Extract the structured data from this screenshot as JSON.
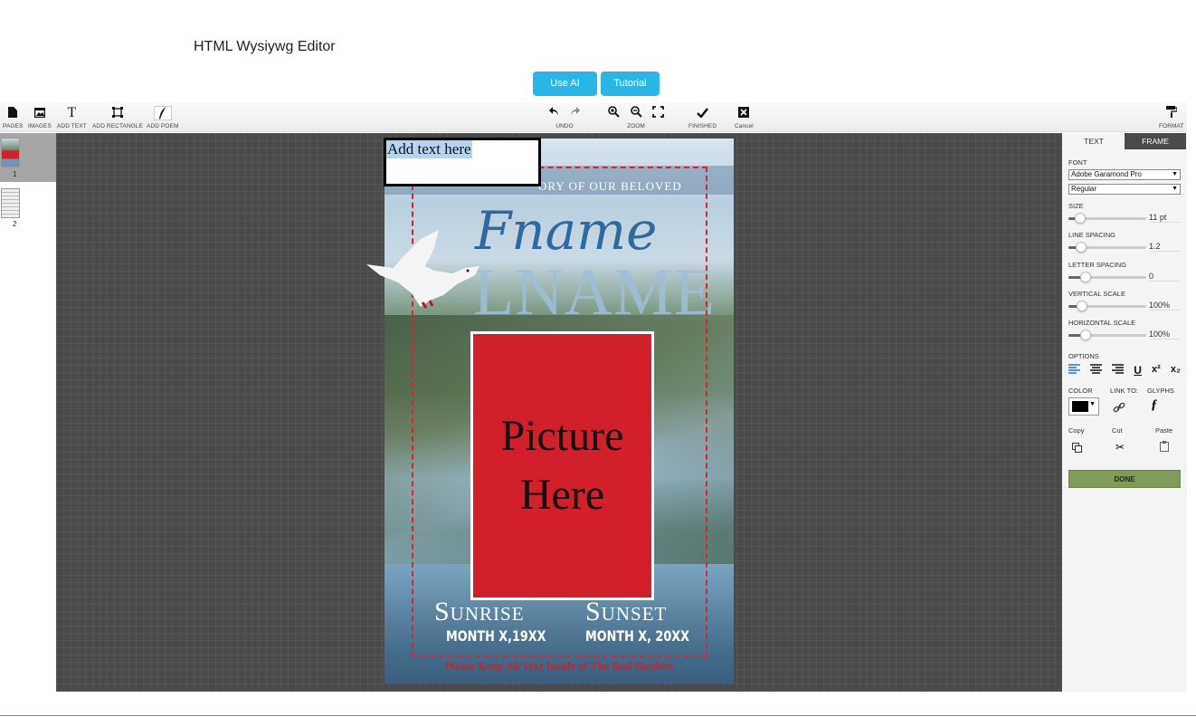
{
  "page": {
    "title": "HTML Wysiywg Editor"
  },
  "top_buttons": {
    "use_ai": "Use AI",
    "tutorial": "Tutorial"
  },
  "toolbar": {
    "pages": "PAGES",
    "images": "IMAGES",
    "add_text": "ADD TEXT",
    "add_rectangle": "ADD RECTANGLE",
    "add_poem": "ADD POEM",
    "undo": "UNDO",
    "zoom": "ZOOM",
    "finished": "FINISHED",
    "cancel": "Cancel",
    "format": "FORMAT"
  },
  "page_thumbs": [
    {
      "num": "1"
    },
    {
      "num": "2"
    }
  ],
  "card": {
    "top_text": "ORY OF OUR BELOVED",
    "fname": "Fname",
    "lname": "LNAME",
    "picture_line1": "Picture",
    "picture_line2": "Here",
    "sunrise": "Sunrise",
    "sunset": "Sunset",
    "date1": "MONTH X,19XX",
    "date2": "MONTH X, 20XX",
    "footer_note": "Please Keep All Text Inside of The Red Borders"
  },
  "textbox": {
    "text": "Add text here"
  },
  "right_panel": {
    "tab_text": "TEXT",
    "tab_frame": "FRAME",
    "font_label": "FONT",
    "font_value": "Adobe Garamond Pro",
    "style_value": "Regular",
    "size_label": "SIZE",
    "size_value": "11 pt",
    "line_spacing_label": "LINE SPACING",
    "line_spacing_value": "1.2",
    "letter_spacing_label": "LETTER SPACING",
    "letter_spacing_value": "0",
    "vertical_scale_label": "VERTICAL SCALE",
    "vertical_scale_value": "100%",
    "horizontal_scale_label": "HORIZONTAL SCALE",
    "horizontal_scale_value": "100%",
    "options_label": "OPTIONS",
    "color_label": "COLOR",
    "link_label": "LINK TO:",
    "glyphs_label": "GLYPHS",
    "copy_label": "Copy",
    "cut_label": "Cut",
    "paste_label": "Paste",
    "done_label": "DONE",
    "text_color": "#000000"
  }
}
